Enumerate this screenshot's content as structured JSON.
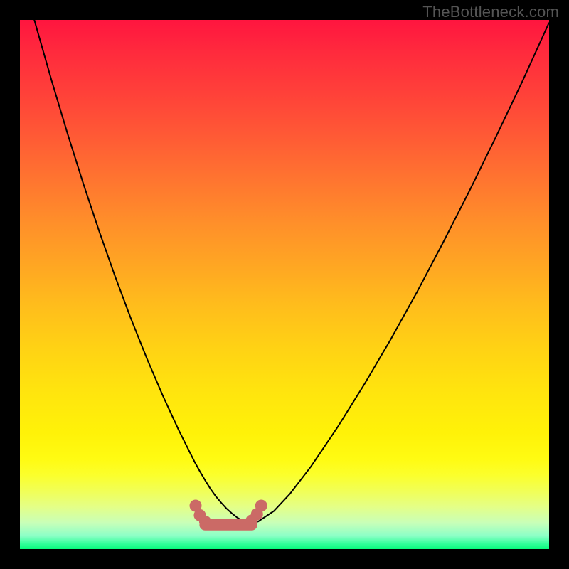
{
  "watermark": "TheBottleneck.com",
  "colors": {
    "curve": "#000000",
    "marker_fill": "#cb6a66",
    "marker_stroke": "#cb6a66"
  },
  "chart_data": {
    "type": "line",
    "title": "",
    "xlabel": "",
    "ylabel": "",
    "xlim": [
      0,
      100
    ],
    "ylim": [
      0,
      100
    ],
    "series": [
      {
        "name": "bottleneck",
        "x": [
          0,
          3,
          6,
          9,
          12,
          15,
          18,
          21,
          24,
          27,
          30,
          33,
          34,
          35,
          36,
          37,
          38,
          39,
          40,
          41,
          42,
          43,
          44,
          45,
          48,
          51,
          55,
          60,
          65,
          70,
          75,
          80,
          85,
          90,
          95,
          100
        ],
        "values": [
          110,
          99,
          88.5,
          78.5,
          69,
          60,
          51.5,
          43.5,
          36,
          29,
          22.5,
          16.5,
          14.7,
          13,
          11.4,
          10,
          8.8,
          7.7,
          6.8,
          6,
          5.4,
          5,
          5,
          5.2,
          7.2,
          10.4,
          15.6,
          23,
          31,
          39.5,
          48.5,
          58,
          67.8,
          78,
          88.5,
          99.5
        ]
      }
    ],
    "markers": [
      {
        "x": 33.2,
        "y": 8.2
      },
      {
        "x": 34.0,
        "y": 6.4
      },
      {
        "x": 35.0,
        "y": 5.2
      },
      {
        "x": 43.8,
        "y": 5.4
      },
      {
        "x": 44.8,
        "y": 6.6
      },
      {
        "x": 45.6,
        "y": 8.2
      }
    ],
    "flat_segment": {
      "x1": 35.0,
      "x2": 43.8,
      "y": 4.6
    }
  }
}
